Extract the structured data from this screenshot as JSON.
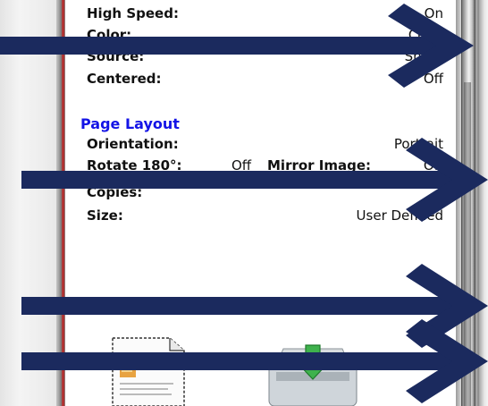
{
  "settings_top": [
    {
      "label": "High Speed:",
      "value": "On"
    },
    {
      "label": "Color:",
      "value": "Color"
    },
    {
      "label": "Source:",
      "value": "Sheet"
    },
    {
      "label": "Centered:",
      "value": "Off"
    }
  ],
  "page_layout": {
    "heading": "Page Layout",
    "orientation": {
      "label": "Orientation:",
      "value": "Portrait"
    },
    "rotate": {
      "label": "Rotate 180°:",
      "value": "Off"
    },
    "mirror": {
      "label": "Mirror Image:",
      "value": "Off"
    },
    "copies": {
      "label": "Copies:",
      "value": ""
    },
    "size": {
      "label": "Size:",
      "value": "User Defined"
    }
  },
  "icons": {
    "document": "document-preview-icon",
    "printer": "printer-icon",
    "arrows": "right-arrow-icon"
  },
  "colors": {
    "section_heading": "#1414e6",
    "arrow": "#1b2a5e",
    "border_accent": "#b11f1f"
  }
}
